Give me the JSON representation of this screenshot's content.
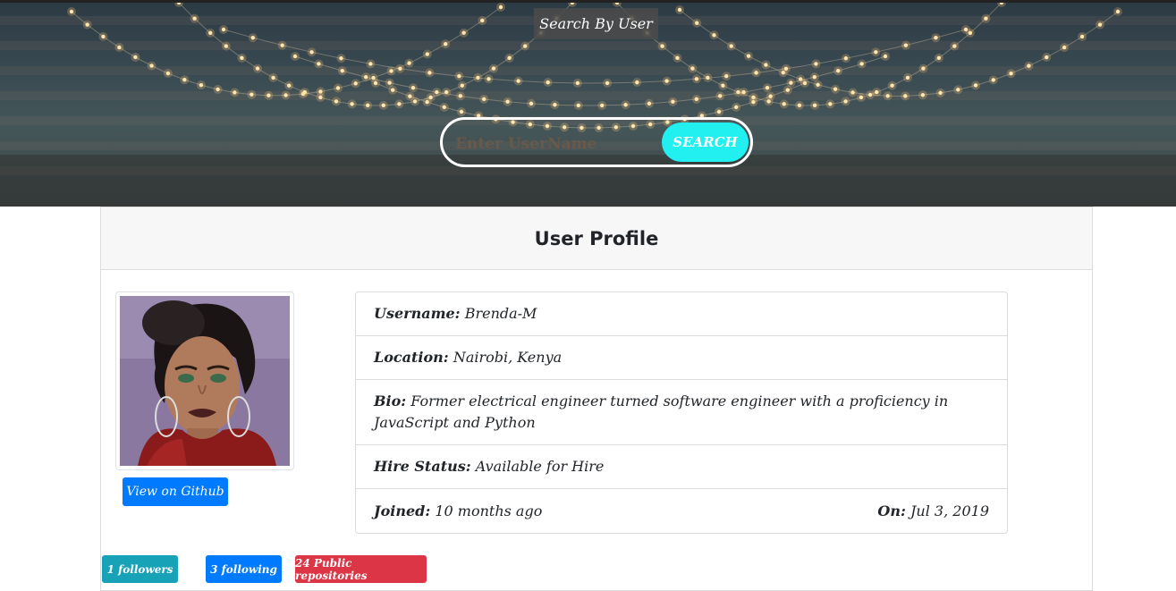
{
  "header": {
    "title": "Search By User",
    "search": {
      "placeholder": "Enter UserName",
      "value": "",
      "button_label": "SEARCH"
    }
  },
  "profile": {
    "title": "User Profile",
    "github_button_label": "View on Github",
    "fields": {
      "username": {
        "label": "Username:",
        "value": "Brenda-M"
      },
      "location": {
        "label": "Location:",
        "value": "Nairobi, Kenya"
      },
      "bio": {
        "label": "Bio:",
        "value": "Former electrical engineer turned software engineer with a proficiency in JavaScript and Python"
      },
      "hire_status": {
        "label": "Hire Status:",
        "value": "Available for Hire"
      },
      "joined": {
        "label": "Joined:",
        "value": "10 months ago"
      },
      "on": {
        "label": "On:",
        "value": "Jul 3, 2019"
      }
    },
    "badges": {
      "followers": "1 followers",
      "following": "3 following",
      "repos": "24 Public repositories"
    }
  },
  "colors": {
    "search_button": "#22f0f0",
    "primary": "#007bff",
    "info": "#17a2b8",
    "danger": "#dc3545"
  }
}
